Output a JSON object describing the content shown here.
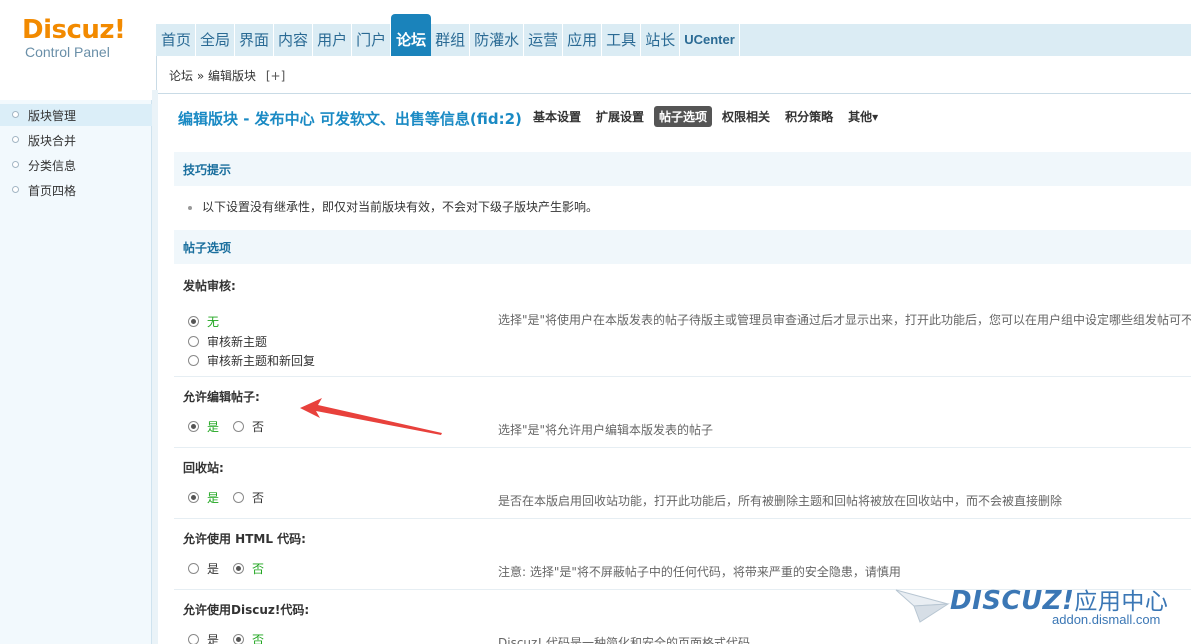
{
  "header": {
    "logo_main_1": "Discuz",
    "logo_bang": "!",
    "logo_sub": "Control Panel",
    "nav": [
      {
        "label": "首页"
      },
      {
        "label": "全局"
      },
      {
        "label": "界面"
      },
      {
        "label": "内容"
      },
      {
        "label": "用户"
      },
      {
        "label": "门户"
      },
      {
        "label": "论坛",
        "active": true
      },
      {
        "label": "群组"
      },
      {
        "label": "防灌水"
      },
      {
        "label": "运营"
      },
      {
        "label": "应用"
      },
      {
        "label": "工具"
      },
      {
        "label": "站长"
      },
      {
        "label": "UCenter"
      }
    ]
  },
  "breadcrumb": {
    "root": "论坛",
    "sep": "»",
    "current": "编辑版块",
    "plus": "[+]"
  },
  "sidebar": {
    "items": [
      {
        "label": "版块管理",
        "active": true
      },
      {
        "label": "版块合并"
      },
      {
        "label": "分类信息"
      },
      {
        "label": "首页四格"
      }
    ]
  },
  "main": {
    "title": "编辑版块 - 发布中心 可发软文、出售等信息(fid:2)",
    "tabs": [
      {
        "label": "基本设置"
      },
      {
        "label": "扩展设置"
      },
      {
        "label": "帖子选项",
        "active": true
      },
      {
        "label": "权限相关"
      },
      {
        "label": "积分策略"
      },
      {
        "label": "其他▾"
      }
    ],
    "tips_head": "技巧提示",
    "tip_text": "以下设置没有继承性，即仅对当前版块有效，不会对下级子版块产生影响。",
    "section_head": "帖子选项",
    "options": {
      "moderation": {
        "label": "发帖审核:",
        "choices": [
          "无",
          "审核新主题",
          "审核新主题和新回复"
        ],
        "selected": "无",
        "desc": "选择\"是\"将使用户在本版发表的帖子待版主或管理员审查通过后才显示出来，打开此功能后，您可以在用户组中设定哪些组发帖可不"
      },
      "allow_edit": {
        "label": "允许编辑帖子:",
        "yes": "是",
        "no": "否",
        "selected": "是",
        "desc": "选择\"是\"将允许用户编辑本版发表的帖子"
      },
      "recycle": {
        "label": "回收站:",
        "yes": "是",
        "no": "否",
        "selected": "是",
        "desc": "是否在本版启用回收站功能，打开此功能后，所有被删除主题和回帖将被放在回收站中，而不会被直接删除"
      },
      "html": {
        "label": "允许使用 HTML 代码:",
        "yes": "是",
        "no": "否",
        "selected": "否",
        "desc": "注意: 选择\"是\"将不屏蔽帖子中的任何代码，将带来严重的安全隐患，请慎用"
      },
      "discuzcode": {
        "label": "允许使用Discuz!代码:",
        "yes": "是",
        "no": "否",
        "selected": "否",
        "desc": "Discuz! 代码是一种简化和安全的页面格式代码"
      }
    }
  },
  "watermark": {
    "brand": "DISCUZ!",
    "cn": "应用中心",
    "url": "addon.dismall.com"
  },
  "colors": {
    "accent": "#1a83bb",
    "selected_text": "#1ca41c",
    "arrow": "#e8413c"
  }
}
